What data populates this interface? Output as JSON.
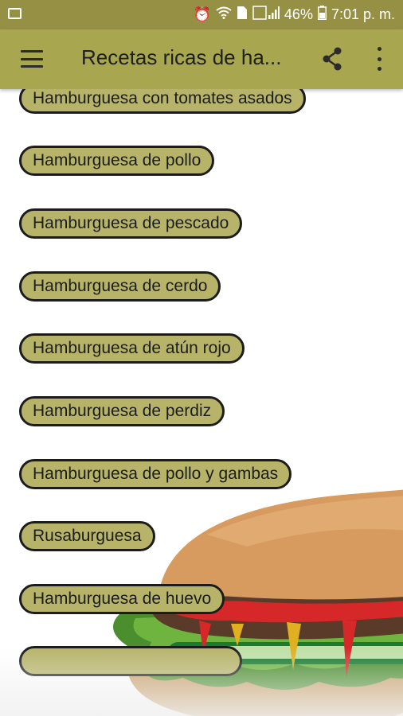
{
  "status_bar": {
    "battery_percent": "46%",
    "time": "7:01 p. m.",
    "icons": [
      "gallery-icon",
      "alarm-icon",
      "wifi-icon",
      "sim-icon",
      "signal-icon",
      "battery-icon"
    ]
  },
  "app_bar": {
    "title": "Recetas ricas de ha...",
    "icons": [
      "menu-icon",
      "share-icon",
      "more-vert-icon"
    ],
    "background": "#a8a64e"
  },
  "recipes": [
    "Hamburguesa con tomates asados",
    "Hamburguesa de pollo",
    "Hamburguesa de pescado",
    "Hamburguesa de cerdo",
    "Hamburguesa de atún rojo",
    "Hamburguesa de perdiz",
    "Hamburguesa de pollo y gambas",
    "Rusaburguesa",
    "Hamburguesa de huevo"
  ],
  "colors": {
    "status_bar": "#969045",
    "chip_fill": "#b7b46a",
    "chip_border": "#1c1c1c"
  }
}
